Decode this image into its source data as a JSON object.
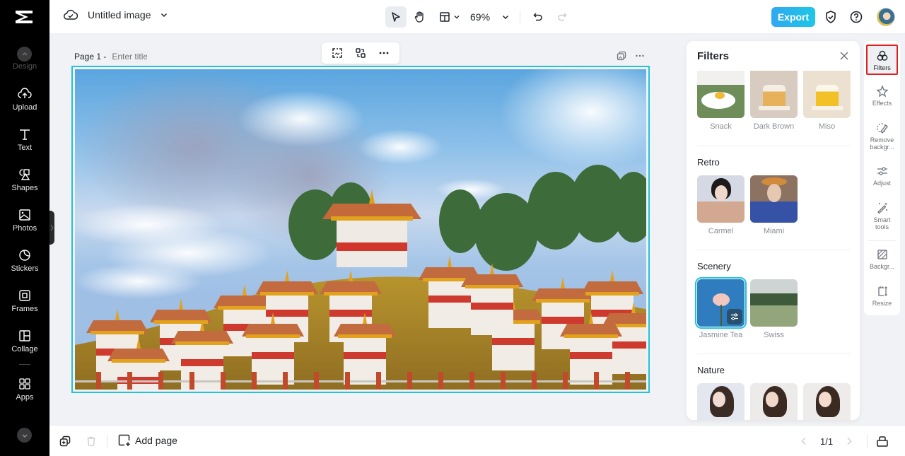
{
  "app": {
    "document_title": "Untitled image",
    "zoom_level": "69%",
    "export_label": "Export"
  },
  "sidebar": {
    "items": [
      {
        "label": "Design",
        "icon": "design-icon"
      },
      {
        "label": "Upload",
        "icon": "upload-cloud-icon"
      },
      {
        "label": "Text",
        "icon": "text-icon"
      },
      {
        "label": "Shapes",
        "icon": "shapes-icon"
      },
      {
        "label": "Photos",
        "icon": "photos-icon"
      },
      {
        "label": "Stickers",
        "icon": "stickers-icon"
      },
      {
        "label": "Frames",
        "icon": "frames-icon"
      },
      {
        "label": "Collage",
        "icon": "collage-icon"
      },
      {
        "label": "Apps",
        "icon": "apps-icon"
      }
    ]
  },
  "canvas": {
    "page_label": "Page 1 -",
    "title_placeholder": "Enter title",
    "image_description": "Druk Wangyal chortens with clouds"
  },
  "bottom": {
    "add_page_label": "Add page",
    "page_indicator": "1/1"
  },
  "filters_panel": {
    "title": "Filters",
    "top_row": [
      {
        "label": "Snack"
      },
      {
        "label": "Dark Brown"
      },
      {
        "label": "Miso"
      }
    ],
    "sections": [
      {
        "title": "Retro",
        "items": [
          {
            "label": "Carmel"
          },
          {
            "label": "Miami"
          }
        ]
      },
      {
        "title": "Scenery",
        "items": [
          {
            "label": "Jasmine Tea",
            "selected": true
          },
          {
            "label": "Swiss"
          }
        ]
      },
      {
        "title": "Nature",
        "items": [
          {
            "label": ""
          },
          {
            "label": ""
          },
          {
            "label": ""
          }
        ]
      }
    ]
  },
  "right_rail": {
    "items": [
      {
        "label": "Filters",
        "active": true
      },
      {
        "label": "Effects"
      },
      {
        "label": "Remove backgr..."
      },
      {
        "label": "Adjust"
      },
      {
        "label": "Smart tools"
      },
      {
        "label": "Backgr..."
      },
      {
        "label": "Resize"
      }
    ]
  },
  "colors": {
    "accent": "#22c3d9",
    "export_gradient_start": "#2fa8f0",
    "export_gradient_end": "#1ec7e6",
    "active_rail_outline": "#e02020"
  }
}
